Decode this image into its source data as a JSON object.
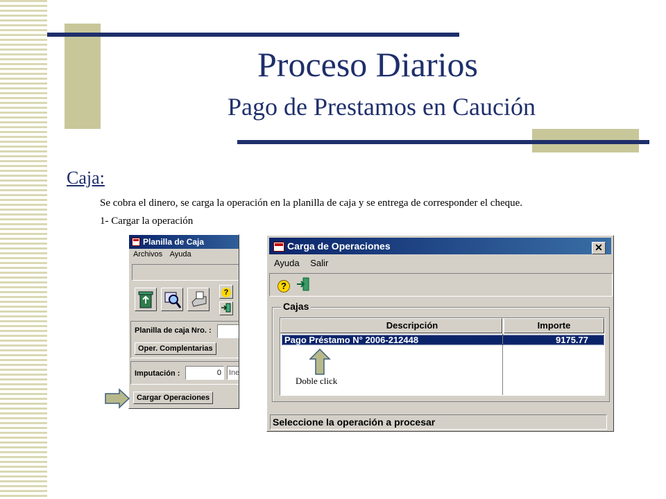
{
  "slide": {
    "title": "Proceso Diarios",
    "subtitle": "Pago de Prestamos en Caución",
    "heading": "Caja:",
    "text1": "Se cobra el dinero, se carga la operación en la planilla de caja y se entrega de corresponder el cheque.",
    "text2": "1- Cargar la operación",
    "annotation": "Doble click"
  },
  "planilla": {
    "title": "Planilla de Caja",
    "menu": [
      "Archivos",
      "Ayuda"
    ],
    "planilla_label": "Planilla de caja Nro. :",
    "oper_btn": "Oper. Complentarias",
    "imputacion_label": "Imputación :",
    "imputacion_value": "0",
    "imputacion_extra": "Ine",
    "cargar_btn": "Cargar Operaciones",
    "icons": [
      "recycle-icon",
      "search-icon",
      "printer-icon",
      "help-icon",
      "exit-icon"
    ]
  },
  "carga": {
    "title": "Carga de Operaciones",
    "close": "✕",
    "menu": [
      "Ayuda",
      "Salir"
    ],
    "group_label": "Cajas",
    "columns": [
      "Descripción",
      "Importe"
    ],
    "rows": [
      {
        "descripcion": "Pago Préstamo N° 2006-212448",
        "importe": "9175.77"
      }
    ],
    "status": "Seleccione la operación a procesar",
    "icons": [
      "help-icon",
      "exit-icon"
    ]
  },
  "colors": {
    "accent_navy": "#1f2f6b",
    "deco_khaki": "#c8c79a",
    "selection": "#0a246a",
    "arrow_fill": "#b7b98a"
  }
}
